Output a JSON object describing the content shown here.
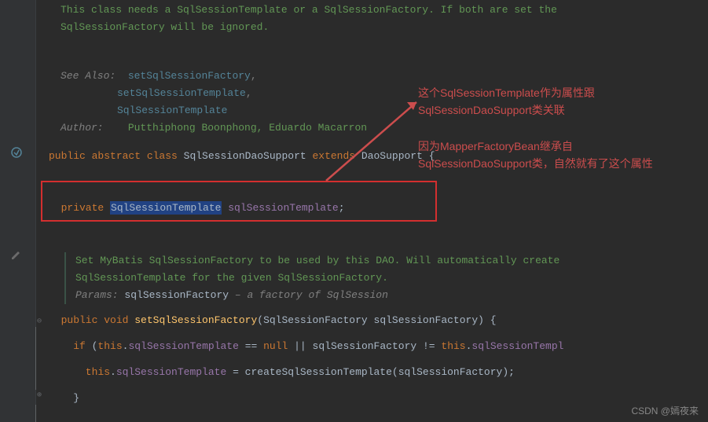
{
  "doc": {
    "intro1": "This class needs a SqlSessionTemplate or a SqlSessionFactory. If both are set the",
    "intro2": "SqlSessionFactory will be ignored.",
    "seeAlso": "See Also:",
    "link1": "setSqlSessionFactory",
    "link2": "setSqlSessionTemplate",
    "link3": "SqlSessionTemplate",
    "authorLabel": "Author:",
    "authorVal": "Putthiphong Boonphong, Eduardo Macarron"
  },
  "code": {
    "classDecl_public": "public ",
    "classDecl_abstract": "abstract ",
    "classDecl_class": "class ",
    "classDecl_name": "SqlSessionDaoSupport ",
    "classDecl_extends": "extends ",
    "classDecl_super": "DaoSupport ",
    "brace_open": "{",
    "field_private": "  private ",
    "field_type": "SqlSessionTemplate",
    "field_name": " sqlSessionTemplate",
    "semi": ";",
    "method_doc1": "Set MyBatis SqlSessionFactory to be used by this DAO. Will automatically create",
    "method_doc2": "SqlSessionTemplate for the given SqlSessionFactory.",
    "method_params_label": "Params: ",
    "method_param_name": "sqlSessionFactory",
    "method_param_desc": " – a factory of SqlSession",
    "m_public": "  public ",
    "m_void": "void ",
    "m_name": "setSqlSessionFactory",
    "m_lp": "(",
    "m_ptype": "SqlSessionFactory ",
    "m_pname": "sqlSessionFactory",
    "m_rp": ")",
    "m_ob": " {",
    "if_kw": "    if ",
    "if_lp": "(",
    "this1": "this",
    "dot": ".",
    "fld1": "sqlSessionTemplate",
    "eq_null": " == ",
    "null_kw": "null",
    "or": " || ",
    "var1": "sqlSessionFactory",
    "neq": " != ",
    "this2": "this",
    "fld2": "sqlSessionTempl",
    "assign_this": "      this",
    "assign_fld": "sqlSessionTemplate",
    "eq": " = ",
    "call": "createSqlSessionTemplate",
    "call_lp": "(",
    "call_arg": "sqlSessionFactory",
    "call_rp": ")",
    "end_semi": ";",
    "cb": "    }"
  },
  "annotations": {
    "a1": "这个SqlSessionTemplate作为属性跟",
    "a2": "SqlSessionDaoSupport类关联",
    "a3": "因为MapperFactoryBean继承自",
    "a4": "SqlSessionDaoSupport类，自然就有了这个属性"
  },
  "watermark": "CSDN @嫣夜来"
}
